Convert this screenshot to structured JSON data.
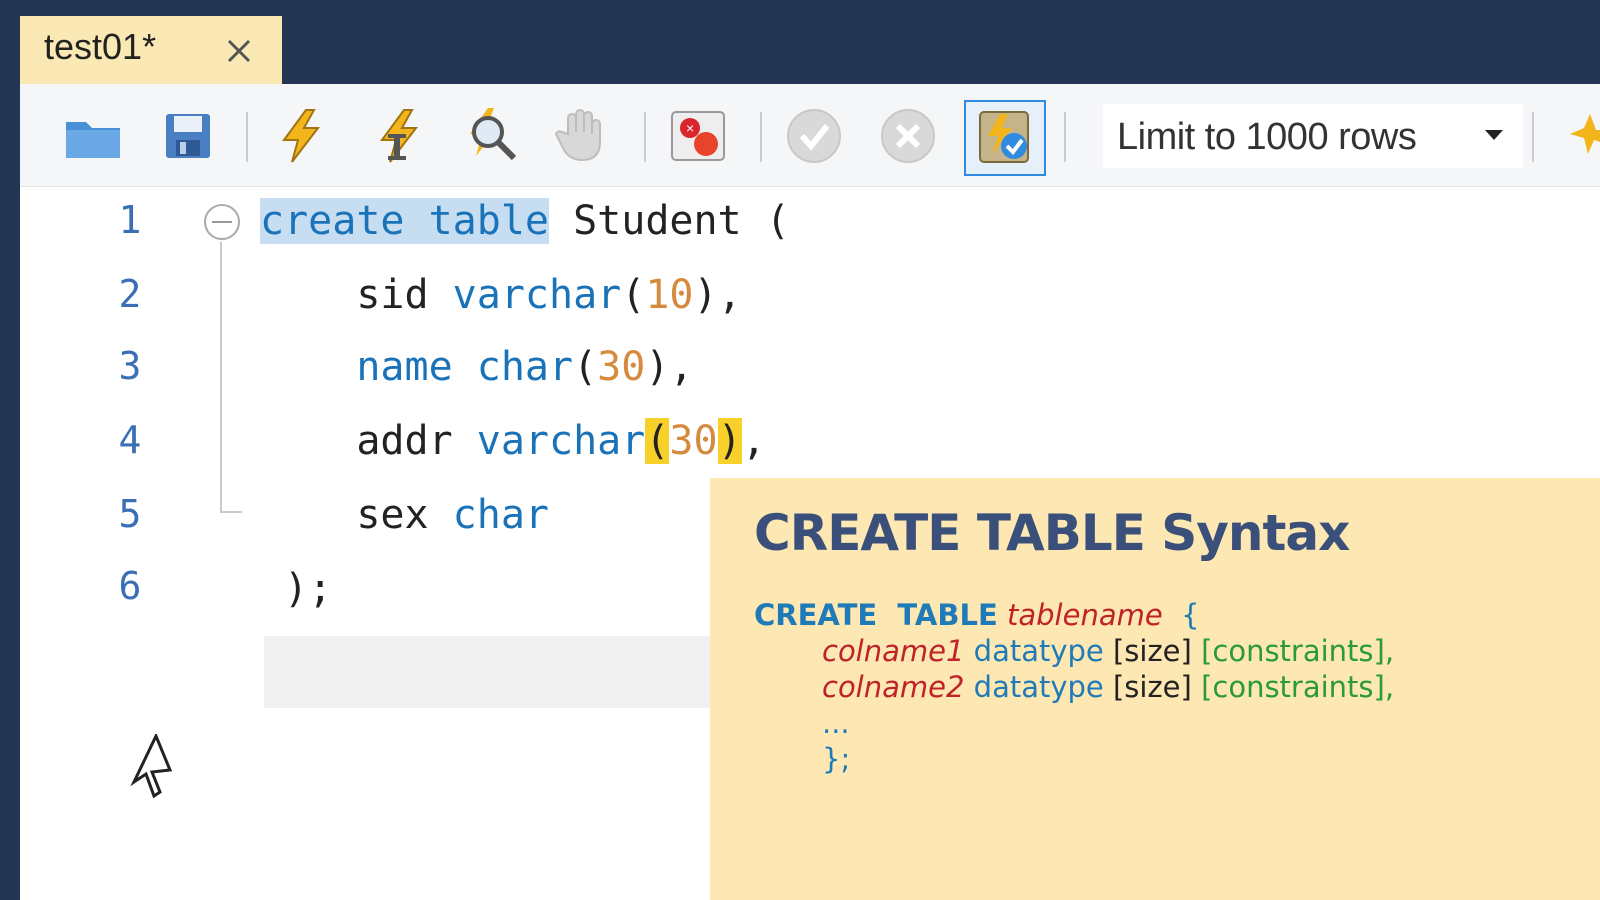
{
  "tab": {
    "title": "test01*"
  },
  "toolbar": {
    "limit_label": "Limit to 1000 rows",
    "icons": [
      "open-folder-icon",
      "save-icon",
      "execute-icon",
      "execute-current-icon",
      "explain-icon",
      "stop-icon",
      "toggle-stop-on-error-icon",
      "commit-icon",
      "rollback-icon",
      "autocommit-icon",
      "dropdown-arrow-icon",
      "star-icon"
    ]
  },
  "editor": {
    "line_numbers": [
      "1",
      "2",
      "3",
      "4",
      "5",
      "6"
    ],
    "lines": [
      {
        "kw": "create table",
        "rest": " Student ("
      },
      {
        "ident": "sid ",
        "type": "varchar",
        "open": "(",
        "num": "10",
        "close": "),",
        "indent": "    "
      },
      {
        "type": "name",
        "space": " ",
        "type2": "char",
        "open": "(",
        "num": "30",
        "close": "),",
        "indent": "    "
      },
      {
        "ident": "addr ",
        "type": "varchar",
        "open": "(",
        "num": "30",
        "close": ")",
        "tail": ",",
        "indent": "    "
      },
      {
        "ident": "sex ",
        "type": "char",
        "indent": "    "
      },
      {
        "text": ");"
      }
    ]
  },
  "syntax_card": {
    "title": "CREATE TABLE Syntax",
    "line1": {
      "kw": "CREATE  TABLE",
      "name": "tablename",
      "brace": "{"
    },
    "line2": {
      "col": "colname1",
      "dtype": "datatype",
      "size": "[size]",
      "cons": "[constraints],",
      "lb": "[",
      "rb": "]"
    },
    "line3": {
      "col": "colname2",
      "dtype": "datatype",
      "size": "[size]",
      "cons": "[constraints],",
      "lb": "[",
      "rb": "]"
    },
    "line4": "...",
    "line5": "};"
  },
  "colors": {
    "tab_bg": "#fbe9b5",
    "frame": "#243654",
    "keyword": "#1a73b8",
    "number": "#d58a3e",
    "card_bg": "#fde7b3"
  }
}
